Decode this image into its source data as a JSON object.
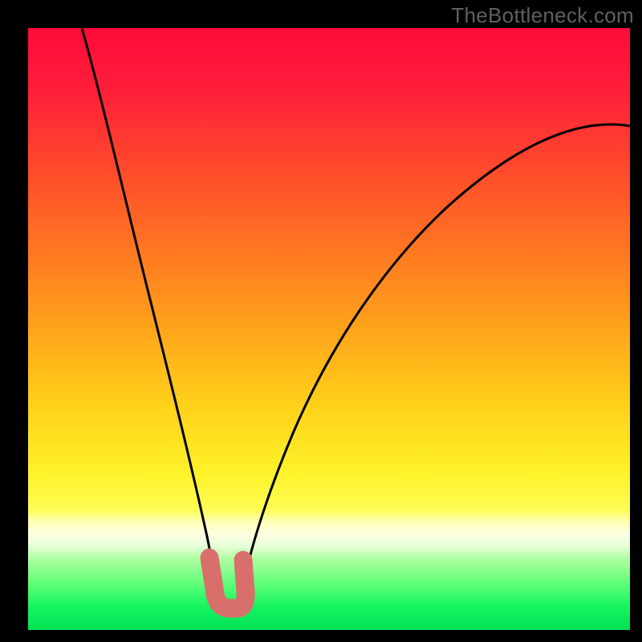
{
  "watermark": "TheBottleneck.com",
  "chart_data": {
    "type": "line",
    "title": "",
    "xlabel": "",
    "ylabel": "",
    "xlim": [
      0,
      100
    ],
    "ylim": [
      0,
      100
    ],
    "grid": false,
    "legend": false,
    "note": "Y interpreted as bottleneck percentage; background color maps Y-value red(high)→green(low).",
    "gradient_stops": [
      {
        "pct": 0,
        "color": "#ff0b3a"
      },
      {
        "pct": 25,
        "color": "#ff4f2a"
      },
      {
        "pct": 50,
        "color": "#ffa41b"
      },
      {
        "pct": 74,
        "color": "#fff22a"
      },
      {
        "pct": 84,
        "color": "#ffffe2"
      },
      {
        "pct": 96,
        "color": "#17f560"
      },
      {
        "pct": 100,
        "color": "#00e255"
      }
    ],
    "series": [
      {
        "name": "left-branch",
        "color": "#000000",
        "x": [
          9,
          12,
          15,
          18,
          21,
          24,
          26,
          28,
          29.5,
          30.5,
          31.2
        ],
        "y": [
          100,
          83,
          68,
          54,
          41,
          29,
          20,
          13,
          8,
          4,
          2
        ]
      },
      {
        "name": "right-branch",
        "color": "#000000",
        "x": [
          35.5,
          37,
          40,
          44,
          50,
          58,
          67,
          77,
          88,
          100
        ],
        "y": [
          2,
          7,
          18,
          30,
          42,
          53,
          63,
          71,
          78,
          84
        ]
      },
      {
        "name": "floor",
        "color": "#000000",
        "x": [
          31.2,
          33,
          34,
          35.5
        ],
        "y": [
          2,
          1.2,
          1.2,
          2
        ]
      },
      {
        "name": "highlight-marker",
        "color": "#d86f6a",
        "type": "scatter",
        "x": [
          30.2,
          30.6,
          31,
          31.5,
          32.5,
          33.5,
          34.5,
          35.2,
          35.5,
          35.6
        ],
        "y": [
          12,
          8.5,
          5.5,
          3.2,
          2,
          2,
          2.3,
          4,
          7,
          10
        ]
      }
    ]
  }
}
